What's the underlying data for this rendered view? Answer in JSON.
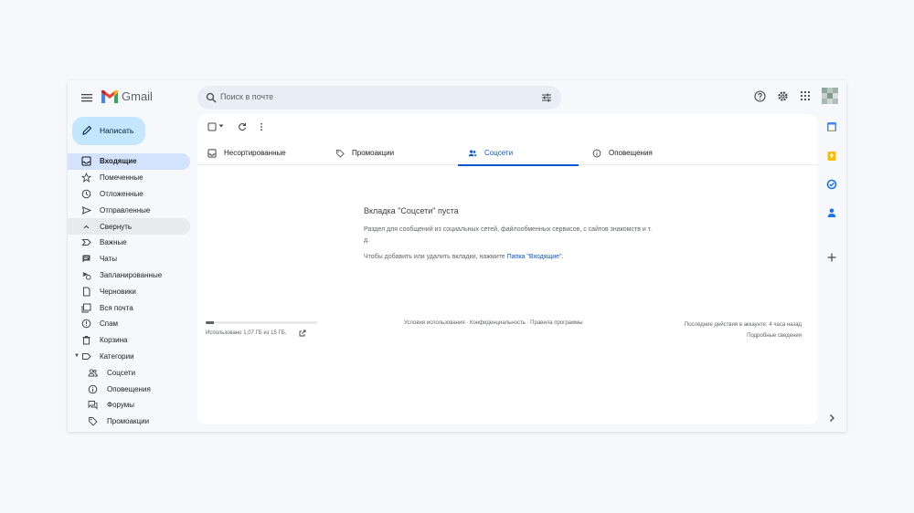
{
  "header": {
    "logo_text": "Gmail",
    "search_placeholder": "Поиск в почте"
  },
  "sidebar": {
    "compose_label": "Написать",
    "items": [
      {
        "label": "Входящие",
        "icon": "inbox-icon",
        "state": "active"
      },
      {
        "label": "Помеченные",
        "icon": "star-icon"
      },
      {
        "label": "Отложенные",
        "icon": "clock-icon"
      },
      {
        "label": "Отправленные",
        "icon": "send-icon"
      },
      {
        "label": "Свернуть",
        "icon": "chevron-up-icon",
        "state": "highlight"
      },
      {
        "label": "Важные",
        "icon": "important-icon"
      },
      {
        "label": "Чаты",
        "icon": "chat-icon"
      },
      {
        "label": "Запланированные",
        "icon": "scheduled-icon"
      },
      {
        "label": "Черновики",
        "icon": "draft-icon"
      },
      {
        "label": "Вся почта",
        "icon": "all-mail-icon"
      },
      {
        "label": "Спам",
        "icon": "spam-icon"
      },
      {
        "label": "Корзина",
        "icon": "trash-icon"
      },
      {
        "label": "Категории",
        "icon": "label-icon"
      }
    ],
    "categories": [
      {
        "label": "Соцсети",
        "icon": "people-icon"
      },
      {
        "label": "Оповещения",
        "icon": "info-icon"
      },
      {
        "label": "Форумы",
        "icon": "forum-icon"
      },
      {
        "label": "Промоакции",
        "icon": "tag-icon"
      }
    ]
  },
  "tabs": [
    {
      "label": "Несортированные",
      "icon": "inbox-icon"
    },
    {
      "label": "Промоакции",
      "icon": "tag-icon"
    },
    {
      "label": "Соцсети",
      "icon": "people-icon",
      "active": true
    },
    {
      "label": "Оповещения",
      "icon": "info-icon"
    }
  ],
  "empty": {
    "title": "Вкладка \"Соцсети\" пуста",
    "desc": "Раздел для сообщений из социальных сетей, файлообменных сервисов, с сайтов знакомств и т. д.",
    "hint_prefix": "Чтобы добавить или удалить вкладки, нажмите ",
    "hint_link": "Папка \"Входящие\"",
    "hint_suffix": "."
  },
  "footer": {
    "storage_text": "Использовано 1,07 ГБ из 15 ГБ.",
    "storage_fraction": 0.07,
    "terms": "Условия использования",
    "privacy": "Конфиденциальность",
    "program": "Правила программы",
    "sep": " · ",
    "activity": "Последние действия в аккаунте: 4 часа назад",
    "details": "Подробные сведения"
  },
  "colors": {
    "accent": "#0b57d0",
    "compose_bg": "#c2e7ff",
    "active_bg": "#d3e3fd"
  }
}
